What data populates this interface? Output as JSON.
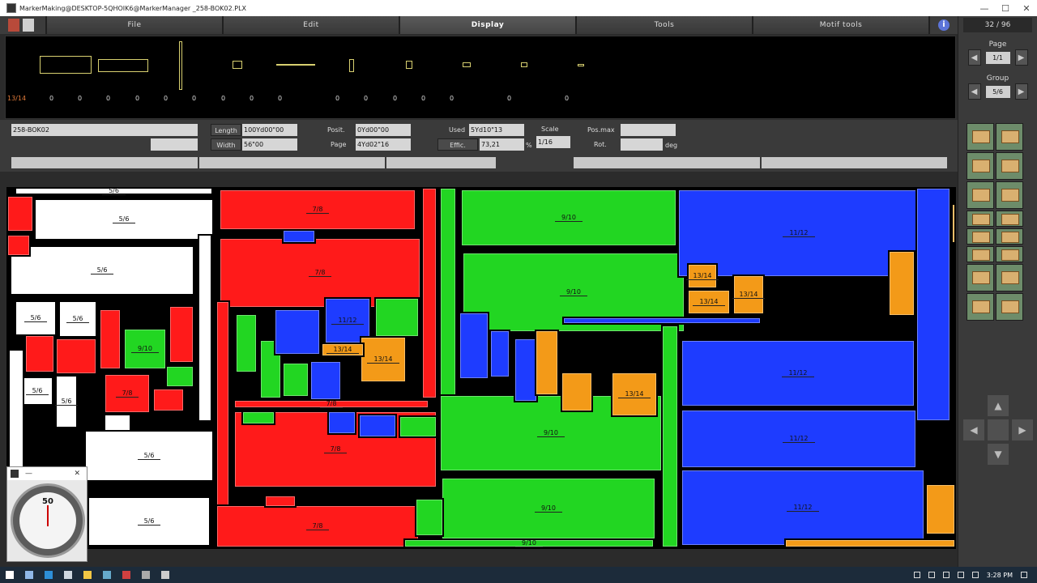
{
  "window": {
    "title": "MarkerMaking@DESKTOP-5QHOIK6@MarkerManager _258-BOK02.PLX",
    "minimize": "—",
    "maximize": "☐",
    "close": "✕"
  },
  "menu": {
    "items": [
      "File",
      "Edit",
      "Display",
      "Tools",
      "Motif tools"
    ],
    "active": "Display",
    "info_icon": "i"
  },
  "preview": {
    "first_count": "13/14",
    "counts": [
      "0",
      "0",
      "0",
      "0",
      "0",
      "0",
      "0",
      "0",
      "0",
      "0",
      "0",
      "0",
      "0",
      "0",
      "0",
      "0",
      "0"
    ]
  },
  "info": {
    "name": "258-BOK02",
    "length_label": "Length",
    "length_value": "100Yd00\"00",
    "width_label": "Width",
    "width_value": "56\"00",
    "posit_label": "Posit.",
    "posit_value": "0Yd00\"00",
    "page_label": "Page",
    "page_value": "4Yd02\"16",
    "used_label": "Used",
    "used_value": "5Yd10\"13",
    "effic_label": "Effic.",
    "effic_value": "73,21",
    "effic_unit": "%",
    "scale_label": "Scale",
    "scale_value": "1/16",
    "posmax_label": "Pos.max",
    "posmax_value": "",
    "rot_label": "Rot.",
    "rot_value": "",
    "rot_unit": "deg"
  },
  "right_panel": {
    "counter": "32 / 96",
    "page_label": "Page",
    "page_value": "1/1",
    "group_label": "Group",
    "group_value": "5/6"
  },
  "marker": {
    "pieces": [
      {
        "label": "5/6",
        "color": "w"
      },
      {
        "label": "5/6",
        "color": "w"
      },
      {
        "label": "5/6",
        "color": "w"
      },
      {
        "label": "5/6",
        "color": "w"
      },
      {
        "label": "5/6",
        "color": "w"
      },
      {
        "label": "5/6",
        "color": "w"
      },
      {
        "label": "5/6",
        "color": "w"
      },
      {
        "label": "5/6",
        "color": "w"
      },
      {
        "label": "5/6",
        "color": "w"
      },
      {
        "label": "7/8",
        "color": "r"
      },
      {
        "label": "7/8",
        "color": "r"
      },
      {
        "label": "7/8",
        "color": "r"
      },
      {
        "label": "7/8",
        "color": "r"
      },
      {
        "label": "7/8",
        "color": "r"
      },
      {
        "label": "7/8",
        "color": "r"
      },
      {
        "label": "9/10",
        "color": "g"
      },
      {
        "label": "9/10",
        "color": "g"
      },
      {
        "label": "9/10",
        "color": "g"
      },
      {
        "label": "9/10",
        "color": "g"
      },
      {
        "label": "9/10",
        "color": "g"
      },
      {
        "label": "9/10",
        "color": "g"
      },
      {
        "label": "11/12",
        "color": "b"
      },
      {
        "label": "11/12",
        "color": "b"
      },
      {
        "label": "11/12",
        "color": "b"
      },
      {
        "label": "11/12",
        "color": "b"
      },
      {
        "label": "11/12",
        "color": "b"
      },
      {
        "label": "13/14",
        "color": "o"
      },
      {
        "label": "13/14",
        "color": "o"
      },
      {
        "label": "13/14",
        "color": "o"
      },
      {
        "label": "13/14",
        "color": "o"
      },
      {
        "label": "13/14",
        "color": "o"
      },
      {
        "label": "13/14",
        "color": "o"
      }
    ]
  },
  "gauge": {
    "value": "50",
    "close": "✕"
  },
  "taskbar": {
    "time": "3:28 PM"
  },
  "colors": {
    "white": "#ffffff",
    "red": "#ff1a1a",
    "green": "#22d622",
    "blue": "#1e3cff",
    "orange": "#f39a18"
  }
}
